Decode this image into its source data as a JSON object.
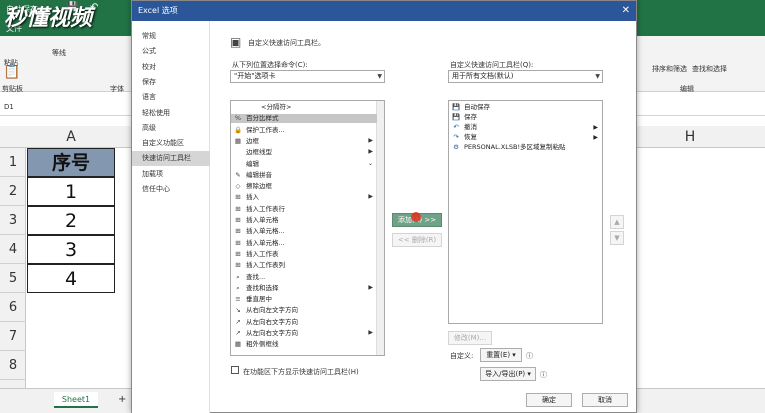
{
  "excel": {
    "autosave_label": "自动保存",
    "file_tab": "文件",
    "paste_label": "粘贴",
    "clipboard_label": "剪贴板",
    "font_name": "等线",
    "font_group": "字体",
    "name_box": "D1",
    "column_a": "A",
    "column_h": "H",
    "sort_filter": "排序和筛选",
    "find_select": "查找和选择",
    "edit_group": "编辑",
    "watermark": "秒懂视频",
    "rows": [
      {
        "num": "1",
        "value": "序号"
      },
      {
        "num": "2",
        "value": "1"
      },
      {
        "num": "3",
        "value": "2"
      },
      {
        "num": "4",
        "value": "3"
      },
      {
        "num": "5",
        "value": "4"
      },
      {
        "num": "6",
        "value": ""
      },
      {
        "num": "7",
        "value": ""
      },
      {
        "num": "8",
        "value": ""
      }
    ],
    "sheet_tab": "Sheet1",
    "add_sheet": "+"
  },
  "dialog": {
    "title": "Excel 选项",
    "close": "✕",
    "nav": [
      "常规",
      "公式",
      "校对",
      "保存",
      "语言",
      "轻松使用",
      "高级",
      "自定义功能区",
      "快速访问工具栏",
      "加载项",
      "信任中心"
    ],
    "nav_selected": 8,
    "header": "自定义快速访问工具栏。",
    "choose_label": "从下列位置选择命令(C):",
    "choose_value": "\"开始\"选项卡",
    "customize_label": "自定义快速访问工具栏(Q):",
    "customize_value": "用于所有文档(默认)",
    "left_items": [
      {
        "icon": "",
        "label": "<分隔符>",
        "sub": ""
      },
      {
        "icon": "%",
        "label": "百分比样式",
        "sub": ""
      },
      {
        "icon": "🔒",
        "label": "保护工作表...",
        "sub": ""
      },
      {
        "icon": "▦",
        "label": "边框",
        "sub": "▶"
      },
      {
        "icon": "",
        "label": "边框线型",
        "sub": "▶"
      },
      {
        "icon": "",
        "label": "编辑",
        "sub": "⌄"
      },
      {
        "icon": "✎",
        "label": "编辑拼音",
        "sub": ""
      },
      {
        "icon": "◇",
        "label": "擦除边框",
        "sub": ""
      },
      {
        "icon": "⊞",
        "label": "插入",
        "sub": "▶"
      },
      {
        "icon": "⊞",
        "label": "插入工作表行",
        "sub": ""
      },
      {
        "icon": "⊞",
        "label": "插入单元格",
        "sub": ""
      },
      {
        "icon": "⊞",
        "label": "插入单元格...",
        "sub": ""
      },
      {
        "icon": "⊞",
        "label": "插入单元格...",
        "sub": ""
      },
      {
        "icon": "⊞",
        "label": "插入工作表",
        "sub": ""
      },
      {
        "icon": "⊞",
        "label": "插入工作表列",
        "sub": ""
      },
      {
        "icon": "⌕",
        "label": "查找...",
        "sub": ""
      },
      {
        "icon": "⌕",
        "label": "查找和选择",
        "sub": "▶"
      },
      {
        "icon": "≡",
        "label": "垂直居中",
        "sub": ""
      },
      {
        "icon": "↘",
        "label": "从右向左文字方向",
        "sub": ""
      },
      {
        "icon": "↗",
        "label": "从左向右文字方向",
        "sub": ""
      },
      {
        "icon": "↗",
        "label": "从左向右文字方向",
        "sub": "▶"
      },
      {
        "icon": "▦",
        "label": "粗外侧框线",
        "sub": ""
      }
    ],
    "left_selected": 1,
    "right_items": [
      {
        "icon": "💾",
        "label": "自动保存",
        "sub": ""
      },
      {
        "icon": "💾",
        "label": "保存",
        "sub": ""
      },
      {
        "icon": "↶",
        "label": "撤消",
        "sub": "▶"
      },
      {
        "icon": "↷",
        "label": "恢复",
        "sub": "▶"
      },
      {
        "icon": "⚙",
        "label": "PERSONAL.XLSB!多区域复制粘贴",
        "sub": ""
      }
    ],
    "add_button": "添加(A) >>",
    "remove_button": "<< 删除(R)",
    "modify_button": "修改(M)...",
    "custom_label": "自定义:",
    "reset_button": "重置(E) ▾",
    "import_export_button": "导入/导出(P) ▾",
    "show_below_label": "在功能区下方显示快速访问工具栏(H)",
    "ok_button": "确定",
    "cancel_button": "取消",
    "accent": "#2b579a"
  }
}
